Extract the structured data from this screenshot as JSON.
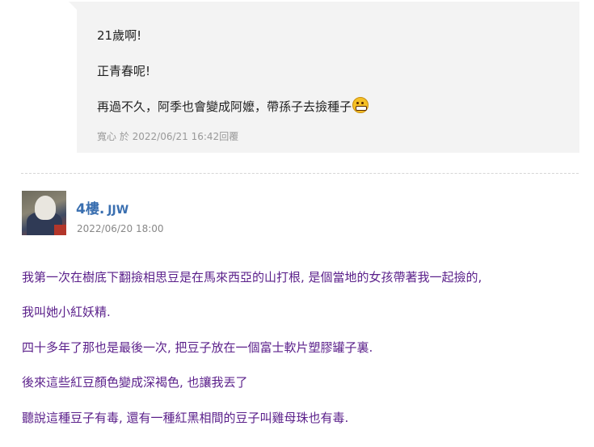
{
  "quote": {
    "lines": [
      "21歲啊!",
      "正青春呢!",
      "再過不久，阿季也會變成阿嬤，帶孫子去撿種子"
    ],
    "emoji_icon": "grinning-emoji-icon",
    "meta": "寬心 於 2022/06/21 16:42回覆"
  },
  "post": {
    "floor": "4樓.",
    "author": "JJW",
    "date": "2022/06/20 18:00",
    "lines": [
      "我第一次在樹底下翻撿相思豆是在馬來西亞的山打根, 是個當地的女孩帶著我一起撿的,",
      "我叫她小紅妖精.",
      "四十多年了那也是最後一次, 把豆子放在一個富士軟片塑膠罐子裏.",
      "後來這些紅豆顏色變成深褐色, 也讓我丟了",
      "聽說這種豆子有毒, 還有一種紅黑相間的豆子叫雞母珠也有毒."
    ]
  },
  "colors": {
    "link": "#3a6fb0",
    "post_text": "#5a1f8a",
    "quote_bg": "#f3f3f3"
  }
}
